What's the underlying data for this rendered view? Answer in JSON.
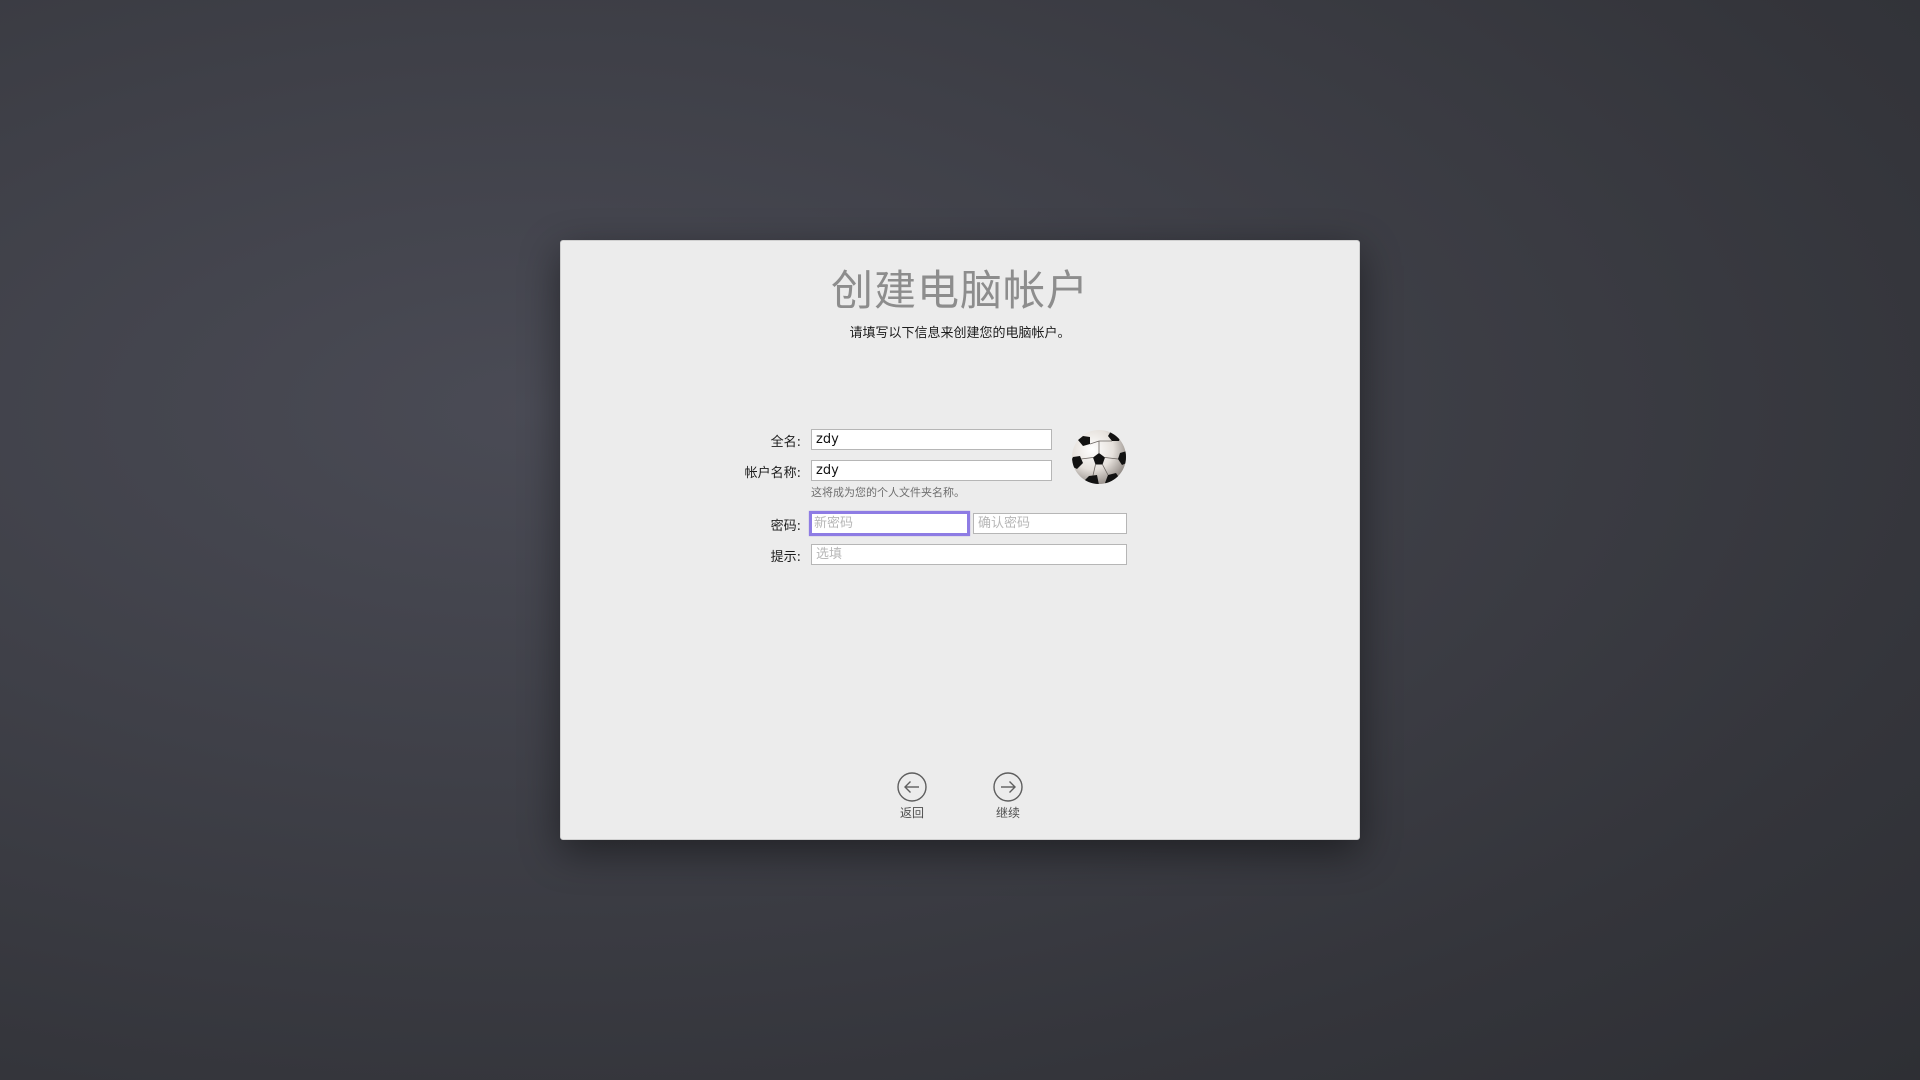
{
  "dialog": {
    "title": "创建电脑帐户",
    "subtitle": "请填写以下信息来创建您的电脑帐户。"
  },
  "form": {
    "full_name_label": "全名:",
    "full_name_value": "zdy",
    "account_name_label": "帐户名称:",
    "account_name_value": "zdy",
    "account_name_note": "这将成为您的个人文件夹名称。",
    "password_label": "密码:",
    "new_password_placeholder": "新密码",
    "confirm_password_placeholder": "确认密码",
    "hint_label": "提示:",
    "hint_placeholder": "选填"
  },
  "avatar": {
    "icon": "soccer-ball-icon"
  },
  "navigation": {
    "back_label": "返回",
    "continue_label": "继续"
  },
  "colors": {
    "focus_ring": "#8e7ce4",
    "dialog_bg": "#ececec",
    "title_color": "#8d8d8d"
  }
}
